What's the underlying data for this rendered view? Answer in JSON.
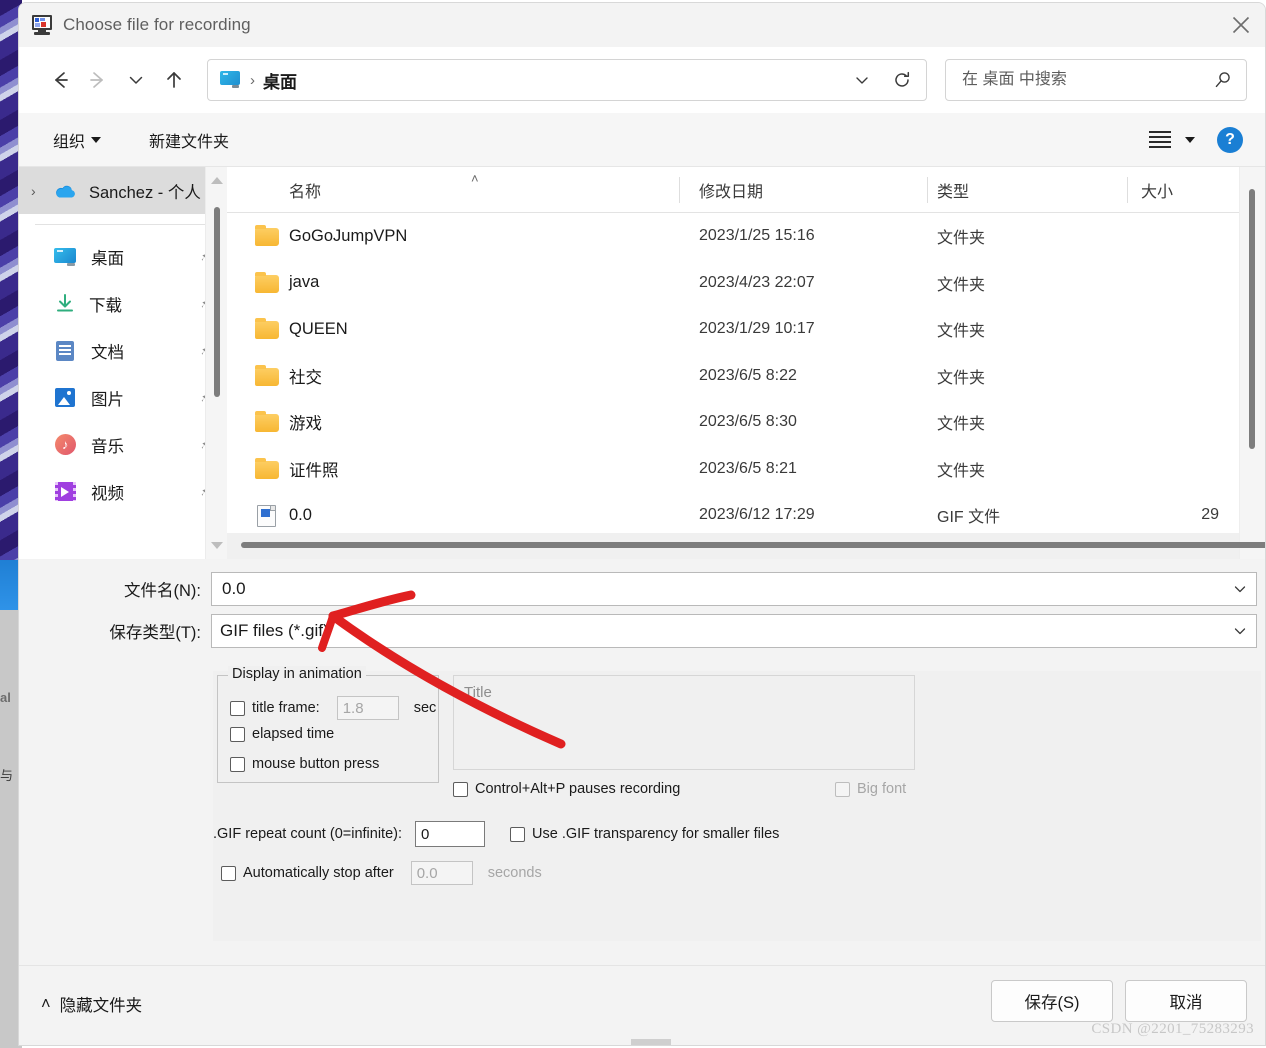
{
  "window": {
    "title": "Choose file for recording",
    "icon": "monitor-recording-icon",
    "close_label": "✕"
  },
  "nav": {
    "back": "←",
    "forward": "→",
    "recent": "⌄",
    "up": "↑",
    "refresh": "⟳",
    "dropdown": "⌄"
  },
  "address": {
    "icon": "desktop-icon",
    "separator": "›",
    "crumb": "桌面"
  },
  "search": {
    "placeholder": "在 桌面 中搜索",
    "value": "",
    "icon": "search-icon"
  },
  "commandbar": {
    "organize": "组织",
    "new_folder": "新建文件夹",
    "view_icon": "list-view-icon",
    "help": "?"
  },
  "sidebar": {
    "onedrive": {
      "chevron": "›",
      "label": "Sanchez - 个人",
      "icon": "onedrive-cloud-icon",
      "selected": true
    },
    "items": [
      {
        "label": "桌面",
        "icon": "desktop-icon",
        "pin": "📌"
      },
      {
        "label": "下载",
        "icon": "downloads-icon",
        "pin": "📌"
      },
      {
        "label": "文档",
        "icon": "documents-icon",
        "pin": "📌"
      },
      {
        "label": "图片",
        "icon": "pictures-icon",
        "pin": "📌"
      },
      {
        "label": "音乐",
        "icon": "music-icon",
        "pin": "📌"
      },
      {
        "label": "视频",
        "icon": "videos-icon",
        "pin": "📌"
      }
    ]
  },
  "filelist": {
    "columns": {
      "name": "名称",
      "date": "修改日期",
      "type": "类型",
      "size": "大小"
    },
    "sort_indicator": "˄",
    "rows": [
      {
        "name": "GoGoJumpVPN",
        "date": "2023/1/25 15:16",
        "type": "文件夹",
        "size": "",
        "icon": "folder-icon"
      },
      {
        "name": "java",
        "date": "2023/4/23 22:07",
        "type": "文件夹",
        "size": "",
        "icon": "folder-icon"
      },
      {
        "name": "QUEEN",
        "date": "2023/1/29 10:17",
        "type": "文件夹",
        "size": "",
        "icon": "folder-icon"
      },
      {
        "name": "社交",
        "date": "2023/6/5 8:22",
        "type": "文件夹",
        "size": "",
        "icon": "folder-icon"
      },
      {
        "name": "游戏",
        "date": "2023/6/5 8:30",
        "type": "文件夹",
        "size": "",
        "icon": "folder-icon"
      },
      {
        "name": "证件照",
        "date": "2023/6/5 8:21",
        "type": "文件夹",
        "size": "",
        "icon": "folder-icon"
      },
      {
        "name": "0.0",
        "date": "2023/6/12 17:29",
        "type": "GIF 文件",
        "size": "29",
        "icon": "gif-file-icon"
      }
    ]
  },
  "fields": {
    "filename_label": "文件名(N):",
    "filename_value": "0.0",
    "filetype_label": "保存类型(T):",
    "filetype_value": "GIF files (*.gif)"
  },
  "options": {
    "group_title": "Display in animation",
    "title_frame": {
      "label": "title frame:",
      "checked": false,
      "value": "1.8",
      "unit": "sec",
      "enabled": false
    },
    "elapsed_time": {
      "label": "elapsed time",
      "checked": false
    },
    "mouse_button_press": {
      "label": "mouse button press",
      "checked": false
    },
    "title_preview_placeholder": "Title",
    "pause_hotkey": {
      "label": "Control+Alt+P pauses recording",
      "checked": false
    },
    "big_font": {
      "label": "Big font",
      "checked": false,
      "enabled": false
    },
    "repeat_count": {
      "label": ".GIF repeat count (0=infinite):",
      "value": "0"
    },
    "transparency": {
      "label": "Use .GIF transparency for smaller files",
      "checked": false
    },
    "auto_stop": {
      "label": "Automatically stop after",
      "checked": false,
      "value": "0.0",
      "unit": "seconds",
      "enabled": false
    }
  },
  "bottom": {
    "hide_folders": "隐藏文件夹",
    "hide_folders_chevron": "˄",
    "save": "保存(S)",
    "cancel": "取消"
  },
  "annotation": {
    "color": "#e02020",
    "shape": "hand-drawn-arrow"
  },
  "watermark": "CSDN @2201_75283293"
}
